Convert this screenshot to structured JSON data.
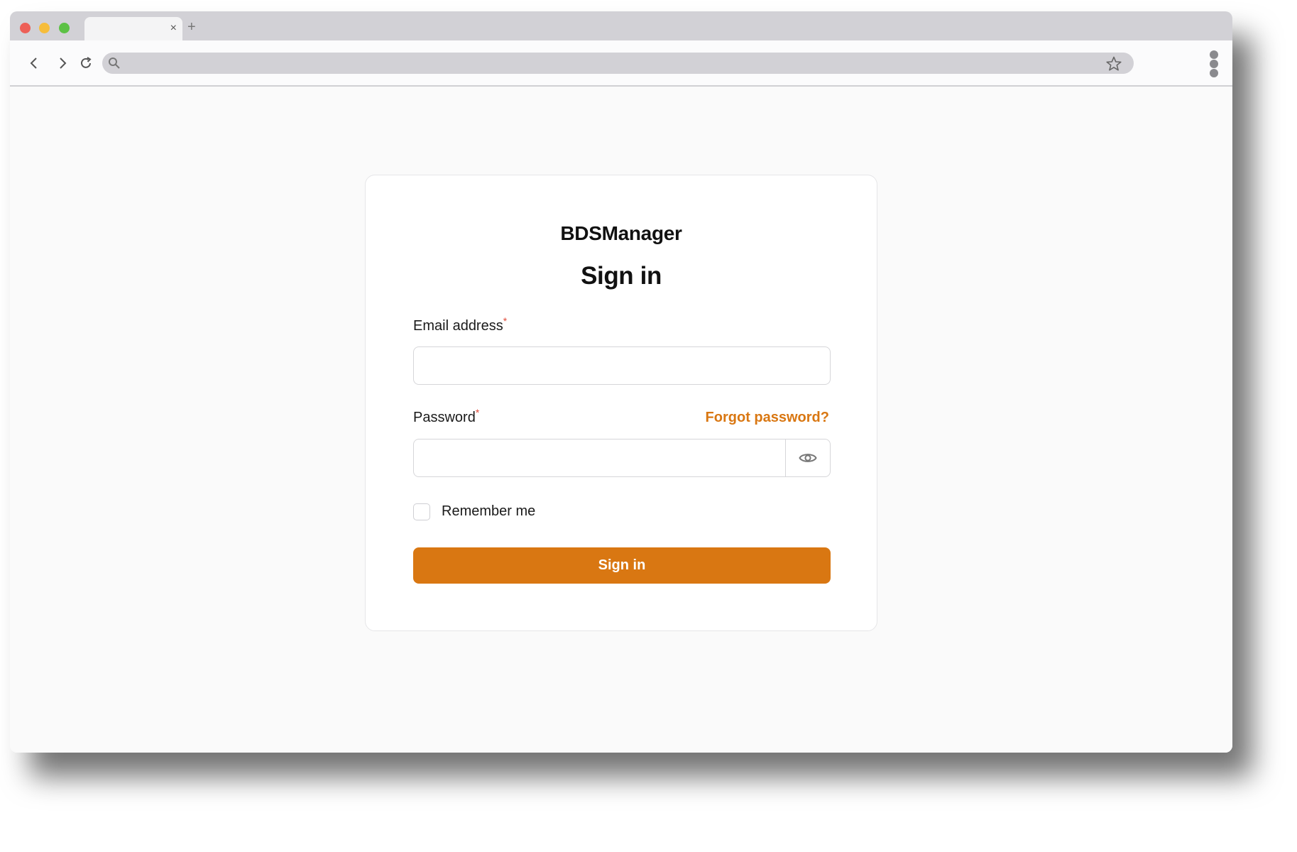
{
  "browser": {
    "tab_close": "×",
    "new_tab": "+"
  },
  "login": {
    "brand": "BDSManager",
    "heading": "Sign in",
    "email_label": "Email address",
    "email_value": "",
    "password_label": "Password",
    "password_value": "",
    "required_marker": "*",
    "forgot_password": "Forgot password?",
    "remember_me": "Remember me",
    "remember_checked": false,
    "submit_label": "Sign in"
  },
  "colors": {
    "accent": "#d97712",
    "required": "#e14b3b"
  },
  "icons": {
    "back": "chevron-left-icon",
    "forward": "chevron-right-icon",
    "reload": "reload-icon",
    "search": "search-icon",
    "bookmark": "star-icon",
    "menu": "kebab-menu-icon",
    "password_toggle": "eye-icon"
  }
}
